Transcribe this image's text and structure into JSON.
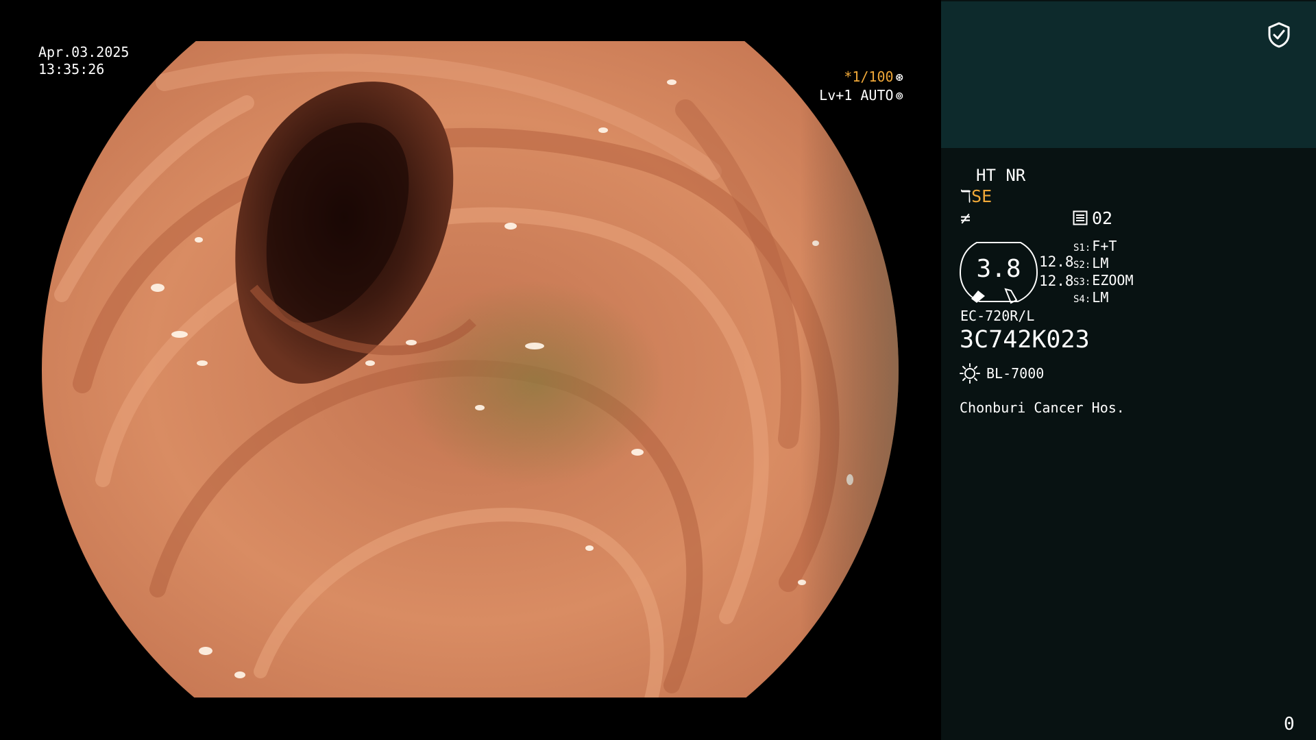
{
  "overlay": {
    "date": "Apr.03.2025",
    "time": "13:35:26",
    "shutter": "*1/100",
    "shutter_icon": "aperture-icon",
    "level": "Lv+1 AUTO",
    "level_icon": "iris-icon"
  },
  "panel": {
    "shield_icon": "shield-check-icon",
    "mode": "HT NR",
    "enhancement": "SE",
    "memory": "02",
    "dial_value": "3.8",
    "value_1": "12.8",
    "value_2": "12.8",
    "switches": [
      {
        "key": "S1:",
        "value": "F+T"
      },
      {
        "key": "S2:",
        "value": "LM"
      },
      {
        "key": "S3:",
        "value": "EZOOM"
      },
      {
        "key": "S4:",
        "value": "LM"
      }
    ],
    "scope_model": "EC-720R/L",
    "scope_serial": "3C742K023",
    "light_source": "BL-7000",
    "hospital": "Chonburi Cancer Hos.",
    "counter": "0"
  },
  "colors": {
    "panel_top": "#0d2a2c",
    "panel_bg": "#081212",
    "accent_orange": "#f0a838",
    "mucosa": "#d7885e"
  }
}
